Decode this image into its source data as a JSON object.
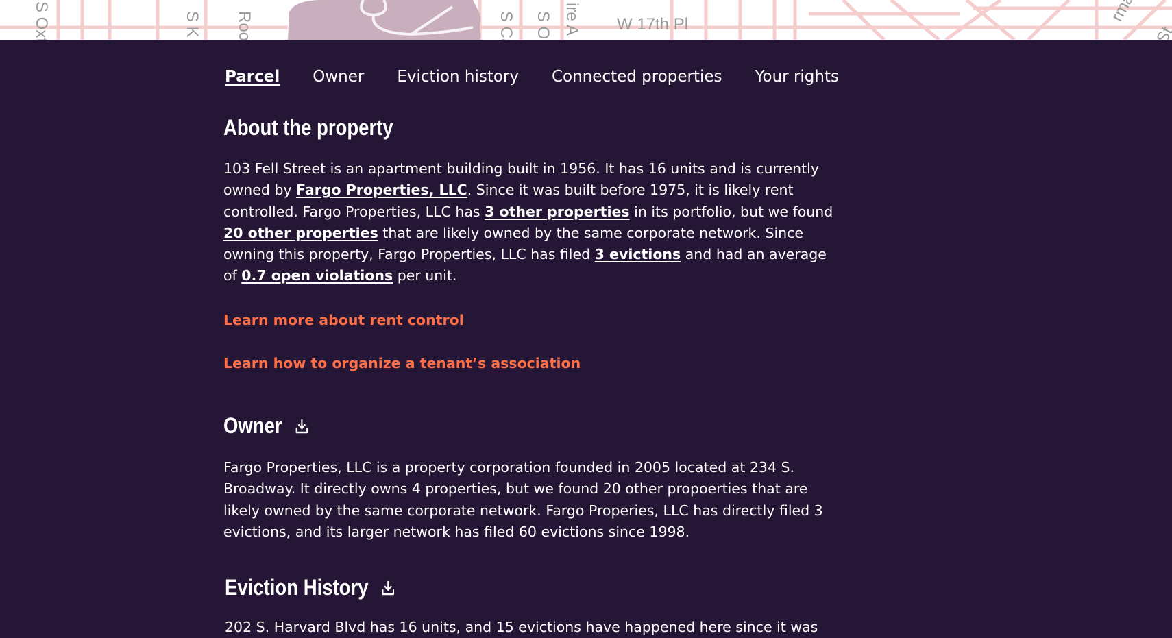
{
  "map": {
    "street_labels": [
      "S Oxf",
      "S K",
      "Roo",
      "S Ca",
      "S O",
      "ire A",
      "W 17th Pl",
      "rman",
      "St"
    ]
  },
  "tabs": [
    {
      "label": "Parcel",
      "active": true
    },
    {
      "label": "Owner",
      "active": false
    },
    {
      "label": "Eviction history",
      "active": false
    },
    {
      "label": "Connected properties",
      "active": false
    },
    {
      "label": "Your rights",
      "active": false
    }
  ],
  "about": {
    "title": "About the property",
    "t1": "103 Fell Street is an apartment building built in 1956. It has 16 units and is currently owned by ",
    "link_owner": "Fargo Properties, LLC",
    "t2": ". Since it was built before 1975, it is likely rent controlled. Fargo Properties, LLC has ",
    "link_other_props": "3 other properties",
    "t3": " in its portfolio, but we found ",
    "link_network_props": "20 other properties",
    "t4": " that are likely owned by the same corporate network. Since owning this property, Fargo Properties, LLC has filed ",
    "link_evictions": "3 evictions",
    "t5": " and had an average of ",
    "link_violations": "0.7 open violations",
    "t6": " per unit.",
    "cta_rent_control": "Learn more about rent control",
    "cta_organize": "Learn how to organize a tenant’s association"
  },
  "owner": {
    "title": "Owner",
    "text": "Fargo Properties, LLC is a property corporation founded in 2005 located at 234 S. Broadway. It directly owns 4 properties, but we found 20 other propoerties that are likely owned by the same corporate network. Fargo Properies, LLC has directly filed 3 evictions, and its larger network has filed 60 evictions since 1998."
  },
  "eviction_history": {
    "title": "Eviction History",
    "text": "202 S. Harvard Blvd has 16 units, and 15 evictions have happened here since it was"
  },
  "colors": {
    "background": "#241634",
    "accent": "#ff6f47",
    "map_roads": "#f4c9c9",
    "map_park": "#c9aebd"
  }
}
